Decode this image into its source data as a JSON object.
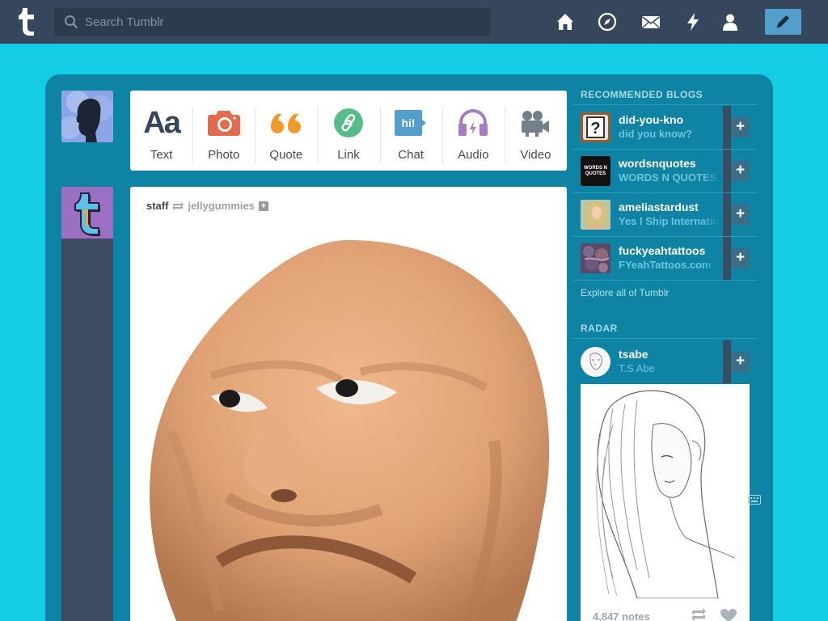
{
  "nav": {
    "search_placeholder": "Search Tumblr",
    "icons": [
      "home-icon",
      "explore-icon",
      "inbox-icon",
      "activity-icon",
      "account-icon"
    ],
    "compose_icon": "pencil-icon"
  },
  "post_types": [
    {
      "label": "Text",
      "icon": "text-icon",
      "glyph": "Aa"
    },
    {
      "label": "Photo",
      "icon": "photo-icon"
    },
    {
      "label": "Quote",
      "icon": "quote-icon"
    },
    {
      "label": "Link",
      "icon": "link-icon"
    },
    {
      "label": "Chat",
      "icon": "chat-icon",
      "glyph": "hi!"
    },
    {
      "label": "Audio",
      "icon": "audio-icon"
    },
    {
      "label": "Video",
      "icon": "video-icon"
    }
  ],
  "post": {
    "author": "staff",
    "reblogged_from": "jellygummies",
    "follow_glyph": "+"
  },
  "recommended": {
    "title": "RECOMMENDED BLOGS",
    "blogs": [
      {
        "name": "did-you-kno",
        "subtitle": "did you know?"
      },
      {
        "name": "wordsnquotes",
        "subtitle": "WORDS N QUOTES",
        "avatar_text": "WORDS N QUOTES"
      },
      {
        "name": "ameliastardust",
        "subtitle": "Yes I Ship Internatio"
      },
      {
        "name": "fuckyeahtattoos",
        "subtitle": "FYeahTattoos.com"
      }
    ],
    "follow_glyph": "+",
    "explore": "Explore all of Tumblr"
  },
  "radar": {
    "title": "RADAR",
    "name": "tsabe",
    "subtitle": "T.S Abe",
    "follow_glyph": "+",
    "notes": "4,847 notes"
  },
  "colors": {
    "background": "#12cde3",
    "nav": "#36465d",
    "dashboard": "#0f83a3",
    "compose": "#529ecc",
    "photo": "#e46a4e",
    "quote": "#f2992e",
    "link": "#56bc8a",
    "chat": "#529ecc",
    "audio": "#a77dc2",
    "video": "#748089"
  }
}
